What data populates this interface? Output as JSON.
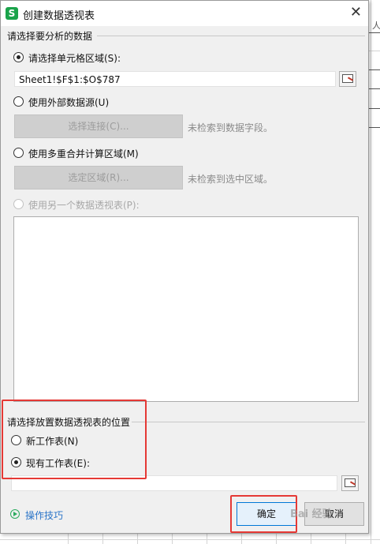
{
  "window": {
    "title": "创建数据透视表",
    "app_icon_letter": "S",
    "close_glyph": "✕"
  },
  "source_section": {
    "label": "请选择要分析的数据",
    "options": [
      {
        "label": "请选择单元格区域(S):",
        "checked": true,
        "disabled": false
      },
      {
        "label": "使用外部数据源(U)",
        "checked": false,
        "disabled": false
      },
      {
        "label": "使用多重合并计算区域(M)",
        "checked": false,
        "disabled": false
      },
      {
        "label": "使用另一个数据透视表(P):",
        "checked": false,
        "disabled": true
      }
    ],
    "range_value": "Sheet1!$F$1:$O$787",
    "select_connection_button": "选择连接(C)...",
    "connection_hint": "未检索到数据字段。",
    "select_region_button": "选定区域(R)...",
    "region_hint": "未检索到选中区域。"
  },
  "placement_section": {
    "label": "请选择放置数据透视表的位置",
    "options": [
      {
        "label": "新工作表(N)",
        "checked": false
      },
      {
        "label": "现有工作表(E):",
        "checked": true
      }
    ],
    "location_value": ""
  },
  "footer": {
    "help_link": "操作技巧",
    "ok_button": "确定",
    "cancel_button": "取消"
  },
  "background_sheet": {
    "partial_text": "人"
  },
  "watermark": {
    "text": "Bai 经验"
  },
  "colors": {
    "highlight": "#e53935",
    "help_link": "#2a74c8",
    "app_icon": "#1aa34a"
  }
}
